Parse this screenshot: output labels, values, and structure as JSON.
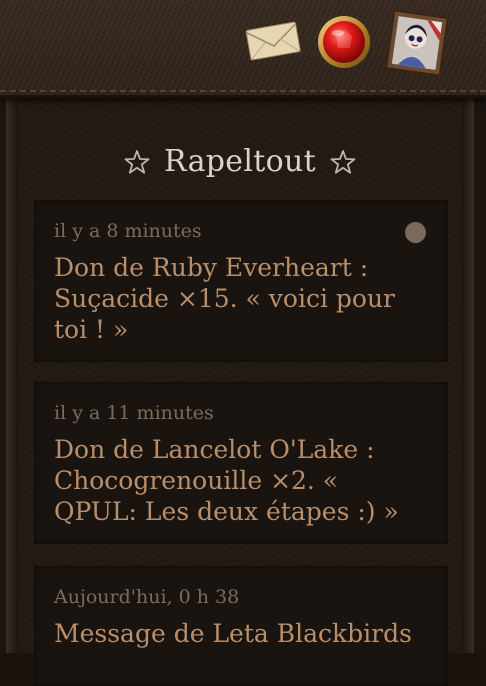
{
  "header": {
    "icons": [
      {
        "name": "mail-envelope-icon"
      },
      {
        "name": "ruby-gem-icon"
      },
      {
        "name": "profile-portrait-icon"
      }
    ]
  },
  "page": {
    "title": "Rapeltout"
  },
  "notifications": [
    {
      "time": "il y a 8 minutes",
      "message": "Don de Ruby Everheart : Suçacide ×15. « voici pour toi ! »",
      "unread": true
    },
    {
      "time": "il y a 11 minutes",
      "message": "Don de Lancelot O'Lake : Chocogrenouille ×2. « QPUL: Les deux étapes :) »",
      "unread": false
    },
    {
      "time": "Aujourd'hui, 0 h 38",
      "message": "Message de Leta Blackbirds",
      "unread": false
    }
  ],
  "colors": {
    "title": "#dcd2c7",
    "time": "#7d6b5b",
    "message": "#b98e6a",
    "card_bg": "#1a1410",
    "panel_bg": "#231a13"
  }
}
